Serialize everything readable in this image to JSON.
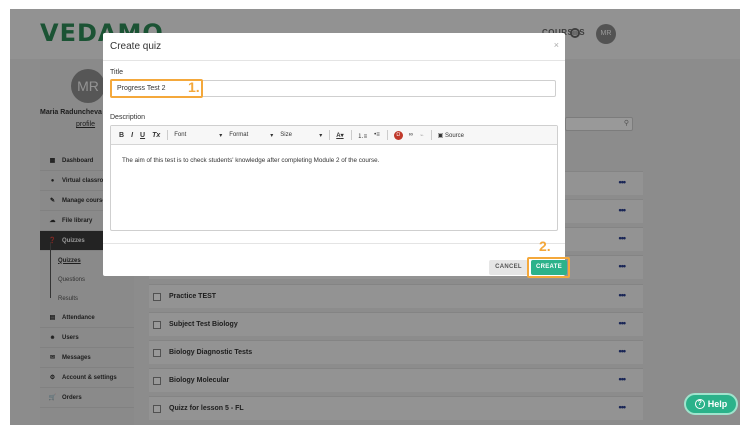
{
  "app": {
    "logo": "VEDAMO",
    "topbar_link": "COURSES",
    "user_initials": "MR",
    "user_name": "Maria Raduncheva",
    "profile_link": "profile"
  },
  "sidebar": {
    "items": [
      {
        "icon": "dashboard-icon",
        "glyph": "▦",
        "label": "Dashboard"
      },
      {
        "icon": "virtual-classroom-icon",
        "glyph": "●",
        "label": "Virtual classrooms"
      },
      {
        "icon": "manage-courses-icon",
        "glyph": "✎",
        "label": "Manage courses"
      },
      {
        "icon": "file-library-icon",
        "glyph": "☁",
        "label": "File library"
      },
      {
        "icon": "quizzes-icon",
        "glyph": "❓",
        "label": "Quizzes"
      }
    ],
    "subitems": [
      "Quizzes",
      "Questions",
      "Results"
    ],
    "items_after": [
      {
        "icon": "attendance-icon",
        "glyph": "▤",
        "label": "Attendance"
      },
      {
        "icon": "users-icon",
        "glyph": "☻",
        "label": "Users"
      },
      {
        "icon": "messages-icon",
        "glyph": "✉",
        "label": "Messages"
      },
      {
        "icon": "settings-icon",
        "glyph": "⚙",
        "label": "Account & settings"
      },
      {
        "icon": "orders-icon",
        "glyph": "🛒",
        "label": "Orders"
      }
    ]
  },
  "quiz_list": {
    "rows": [
      {
        "name": ""
      },
      {
        "name": ""
      },
      {
        "name": ""
      },
      {
        "name": ""
      },
      {
        "name": "Practice TEST"
      },
      {
        "name": "Subject Test Biology"
      },
      {
        "name": "Biology Diagnostic Tests"
      },
      {
        "name": "Biology Molecular"
      },
      {
        "name": "Quizz for lesson 5 - FL"
      }
    ],
    "more_glyph": "•••"
  },
  "modal": {
    "title": "Create quiz",
    "close_glyph": "×",
    "title_label": "Title",
    "title_value": "Progress Test 2",
    "description_label": "Description",
    "toolbar": {
      "bold": "B",
      "italic": "I",
      "underline": "U",
      "clear_format": "Tx",
      "font": "Font",
      "format": "Format",
      "size": "Size",
      "text_color": "A",
      "source": "Source"
    },
    "description_text": "The aim of this test is to check students' knowledge after completing Module 2 of the course.",
    "cancel_label": "CANCEL",
    "create_label": "CREATE"
  },
  "annotations": {
    "step1": "1.",
    "step2": "2."
  },
  "help": {
    "label": "Help"
  },
  "colors": {
    "accent": "#2bb28a",
    "highlight": "#f4a83b",
    "logo": "#2e8b57"
  }
}
